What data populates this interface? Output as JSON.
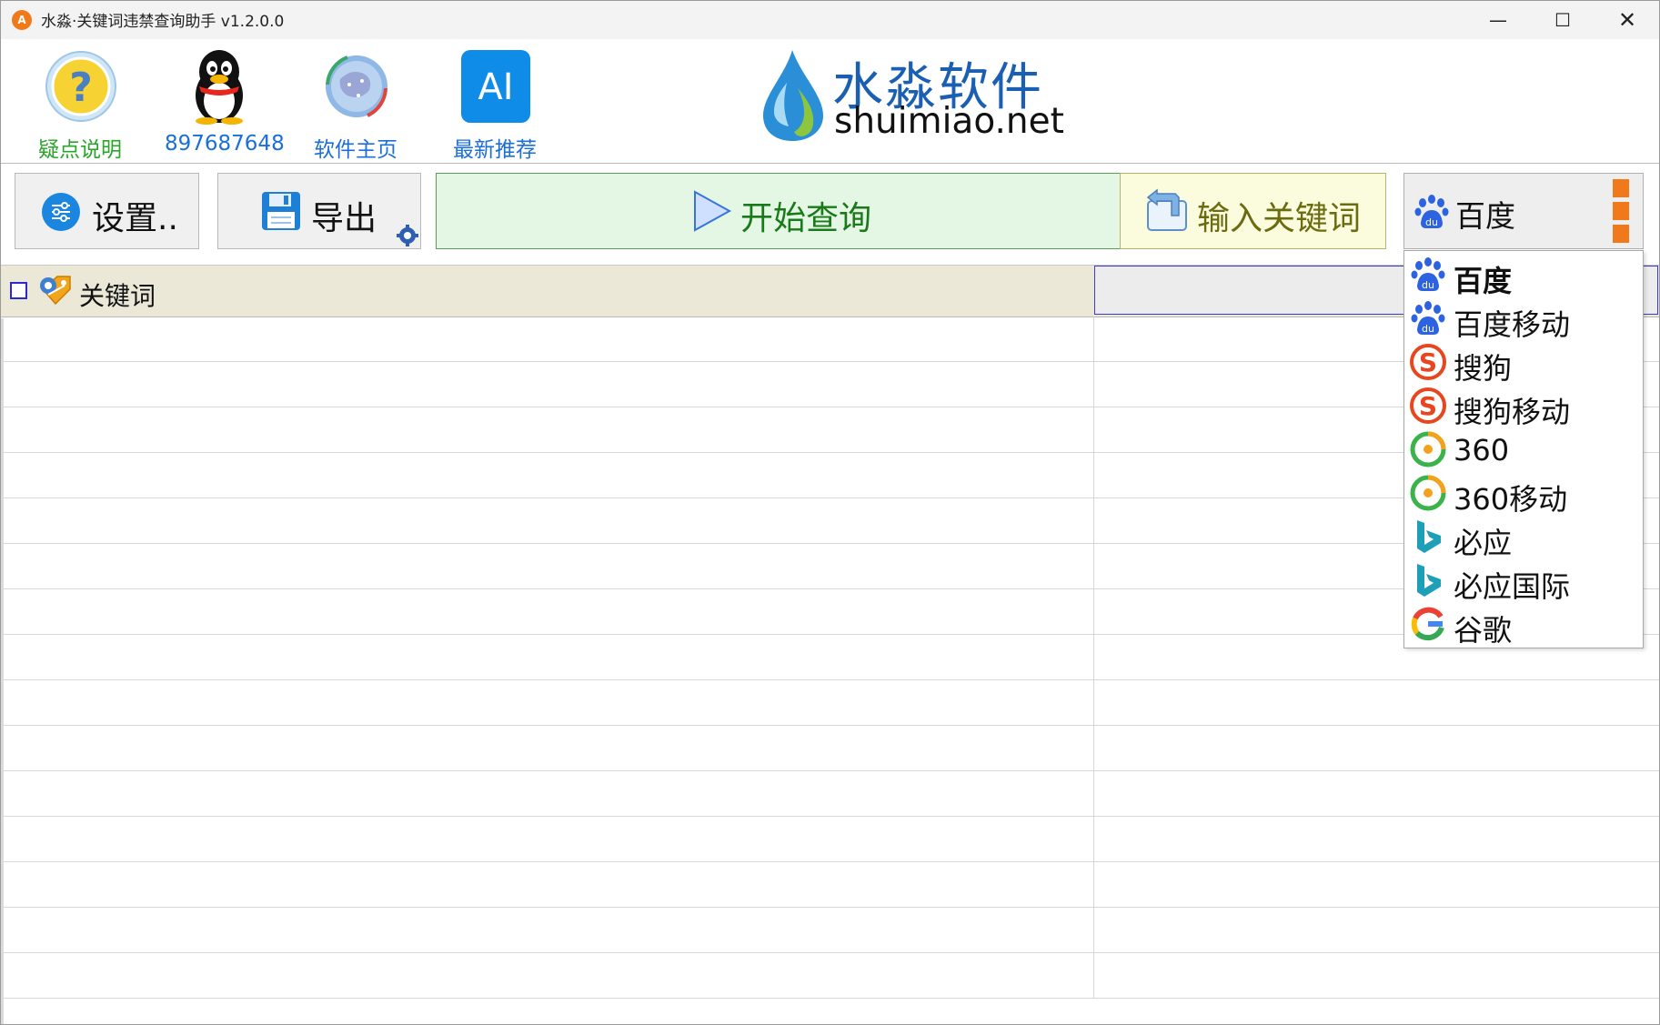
{
  "window": {
    "title": "水淼·关键词违禁查询助手 v1.2.0.0",
    "controls": {
      "minimize": "—",
      "maximize": "☐",
      "close": "✕"
    }
  },
  "toolbar": {
    "items": [
      {
        "label": "疑点说明",
        "icon": "help-question-icon",
        "color": "#2aa52a"
      },
      {
        "label": "897687648",
        "icon": "qq-penguin-icon",
        "color": "#1b6fd8"
      },
      {
        "label": "软件主页",
        "icon": "globe-icon",
        "color": "#1b6fd8"
      },
      {
        "label": "最新推荐",
        "icon": "ai-icon",
        "color": "#1b6fd8",
        "icon_text": "AI"
      }
    ]
  },
  "logo": {
    "cn": "水淼软件",
    "en": "shuimiao.net"
  },
  "buttons": {
    "settings": "设置..",
    "export": "导出",
    "start": "开始查询",
    "input_keywords": "输入关键词"
  },
  "engine": {
    "selected": "百度",
    "options": [
      {
        "label": "百度",
        "icon": "baidu-paw-icon"
      },
      {
        "label": "百度移动",
        "icon": "baidu-paw-icon"
      },
      {
        "label": "搜狗",
        "icon": "sogou-icon"
      },
      {
        "label": "搜狗移动",
        "icon": "sogou-icon"
      },
      {
        "label": "360",
        "icon": "so360-icon"
      },
      {
        "label": "360移动",
        "icon": "so360-icon"
      },
      {
        "label": "必应",
        "icon": "bing-icon"
      },
      {
        "label": "必应国际",
        "icon": "bing-icon"
      },
      {
        "label": "谷歌",
        "icon": "google-icon"
      }
    ]
  },
  "table": {
    "header": "关键词",
    "rows": 15
  },
  "colors": {
    "link_blue": "#1b6fd8",
    "help_green": "#2aa52a",
    "start_bg": "#e4f7e4",
    "start_text": "#1a7a1a",
    "input_bg": "#fbfbdd",
    "input_text": "#6b6b10",
    "header_bg": "#ebe8d8",
    "logo_blue": "#1b5fb3",
    "engine_orange": "#f07a1a"
  }
}
